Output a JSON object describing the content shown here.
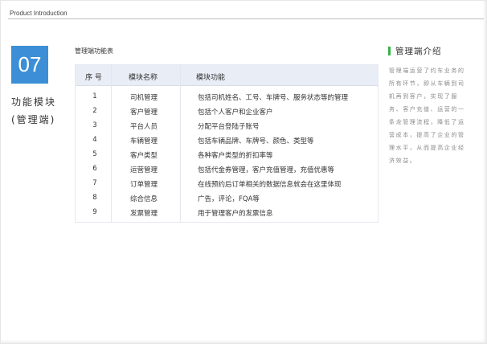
{
  "header": {
    "title": "Product Introduction"
  },
  "section": {
    "number": "07",
    "title_line1": "功能模块",
    "title_line2": "(管理端)"
  },
  "table": {
    "caption": "管理端功能表",
    "headers": [
      "序 号",
      "模块名称",
      "模块功能"
    ],
    "rows": [
      [
        "1",
        "司机管理",
        "包括司机姓名、工号、车牌号、服务状态等的管理"
      ],
      [
        "2",
        "客户管理",
        "包括个人客户和企业客户"
      ],
      [
        "3",
        "平台人员",
        "分配平台登陆子账号"
      ],
      [
        "4",
        "车辆管理",
        "包括车辆品牌、车牌号、颜色、类型等"
      ],
      [
        "5",
        "客户类型",
        "各种客户类型的折扣率等"
      ],
      [
        "6",
        "运营管理",
        "包括代金券管理，客户充值管理，充值优惠等"
      ],
      [
        "7",
        "订单管理",
        "在线预约后订单相关的数据信息就会在这里体现"
      ],
      [
        "8",
        "综合信息",
        "广告，评论，FQA等"
      ],
      [
        "9",
        "发票管理",
        "用于管理客户的发票信息"
      ]
    ]
  },
  "intro": {
    "title": "管理端介绍",
    "body": "管理端运营了约车业务的所有环节，即从车辆到司机再到客户，实现了服务、客户充值、运营的一条龙管理流程，降低了运营成本，提高了企业的管理水平，从而提高企业经济效益。",
    "accent_color": "#36b24a"
  },
  "colors": {
    "number_box": "#3c8fd6",
    "table_header_bg": "#e9edf6"
  }
}
